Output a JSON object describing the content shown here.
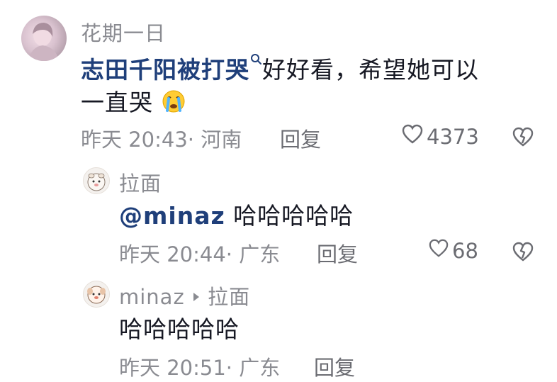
{
  "main_comment": {
    "username": "花期一日",
    "hashtag": "志田千阳被打哭",
    "text_line1": "好好看，希望她可以",
    "text_line2": "一直哭",
    "emoji": "crying-face",
    "time": "昨天 20:43",
    "location": "· 河南",
    "reply_label": "回复",
    "like_count": "4373"
  },
  "reply1": {
    "username": "拉面",
    "mention": "@minaz",
    "text": "哈哈哈哈哈",
    "time": "昨天 20:44",
    "location": "· 广东",
    "reply_label": "回复",
    "like_count": "68"
  },
  "reply2": {
    "username": "minaz",
    "reply_to": "拉面",
    "text": "哈哈哈哈哈",
    "time": "昨天 20:51",
    "location": "· 广东",
    "reply_label": "回复"
  },
  "icons": {
    "search_hashtag": "search-icon",
    "like": "heart-outline-icon",
    "dislike": "broken-heart-icon",
    "reply_arrow": "triangle-right-icon"
  },
  "colors": {
    "link": "#1f3f7a",
    "meta": "#8a8b91",
    "text": "#161823"
  }
}
